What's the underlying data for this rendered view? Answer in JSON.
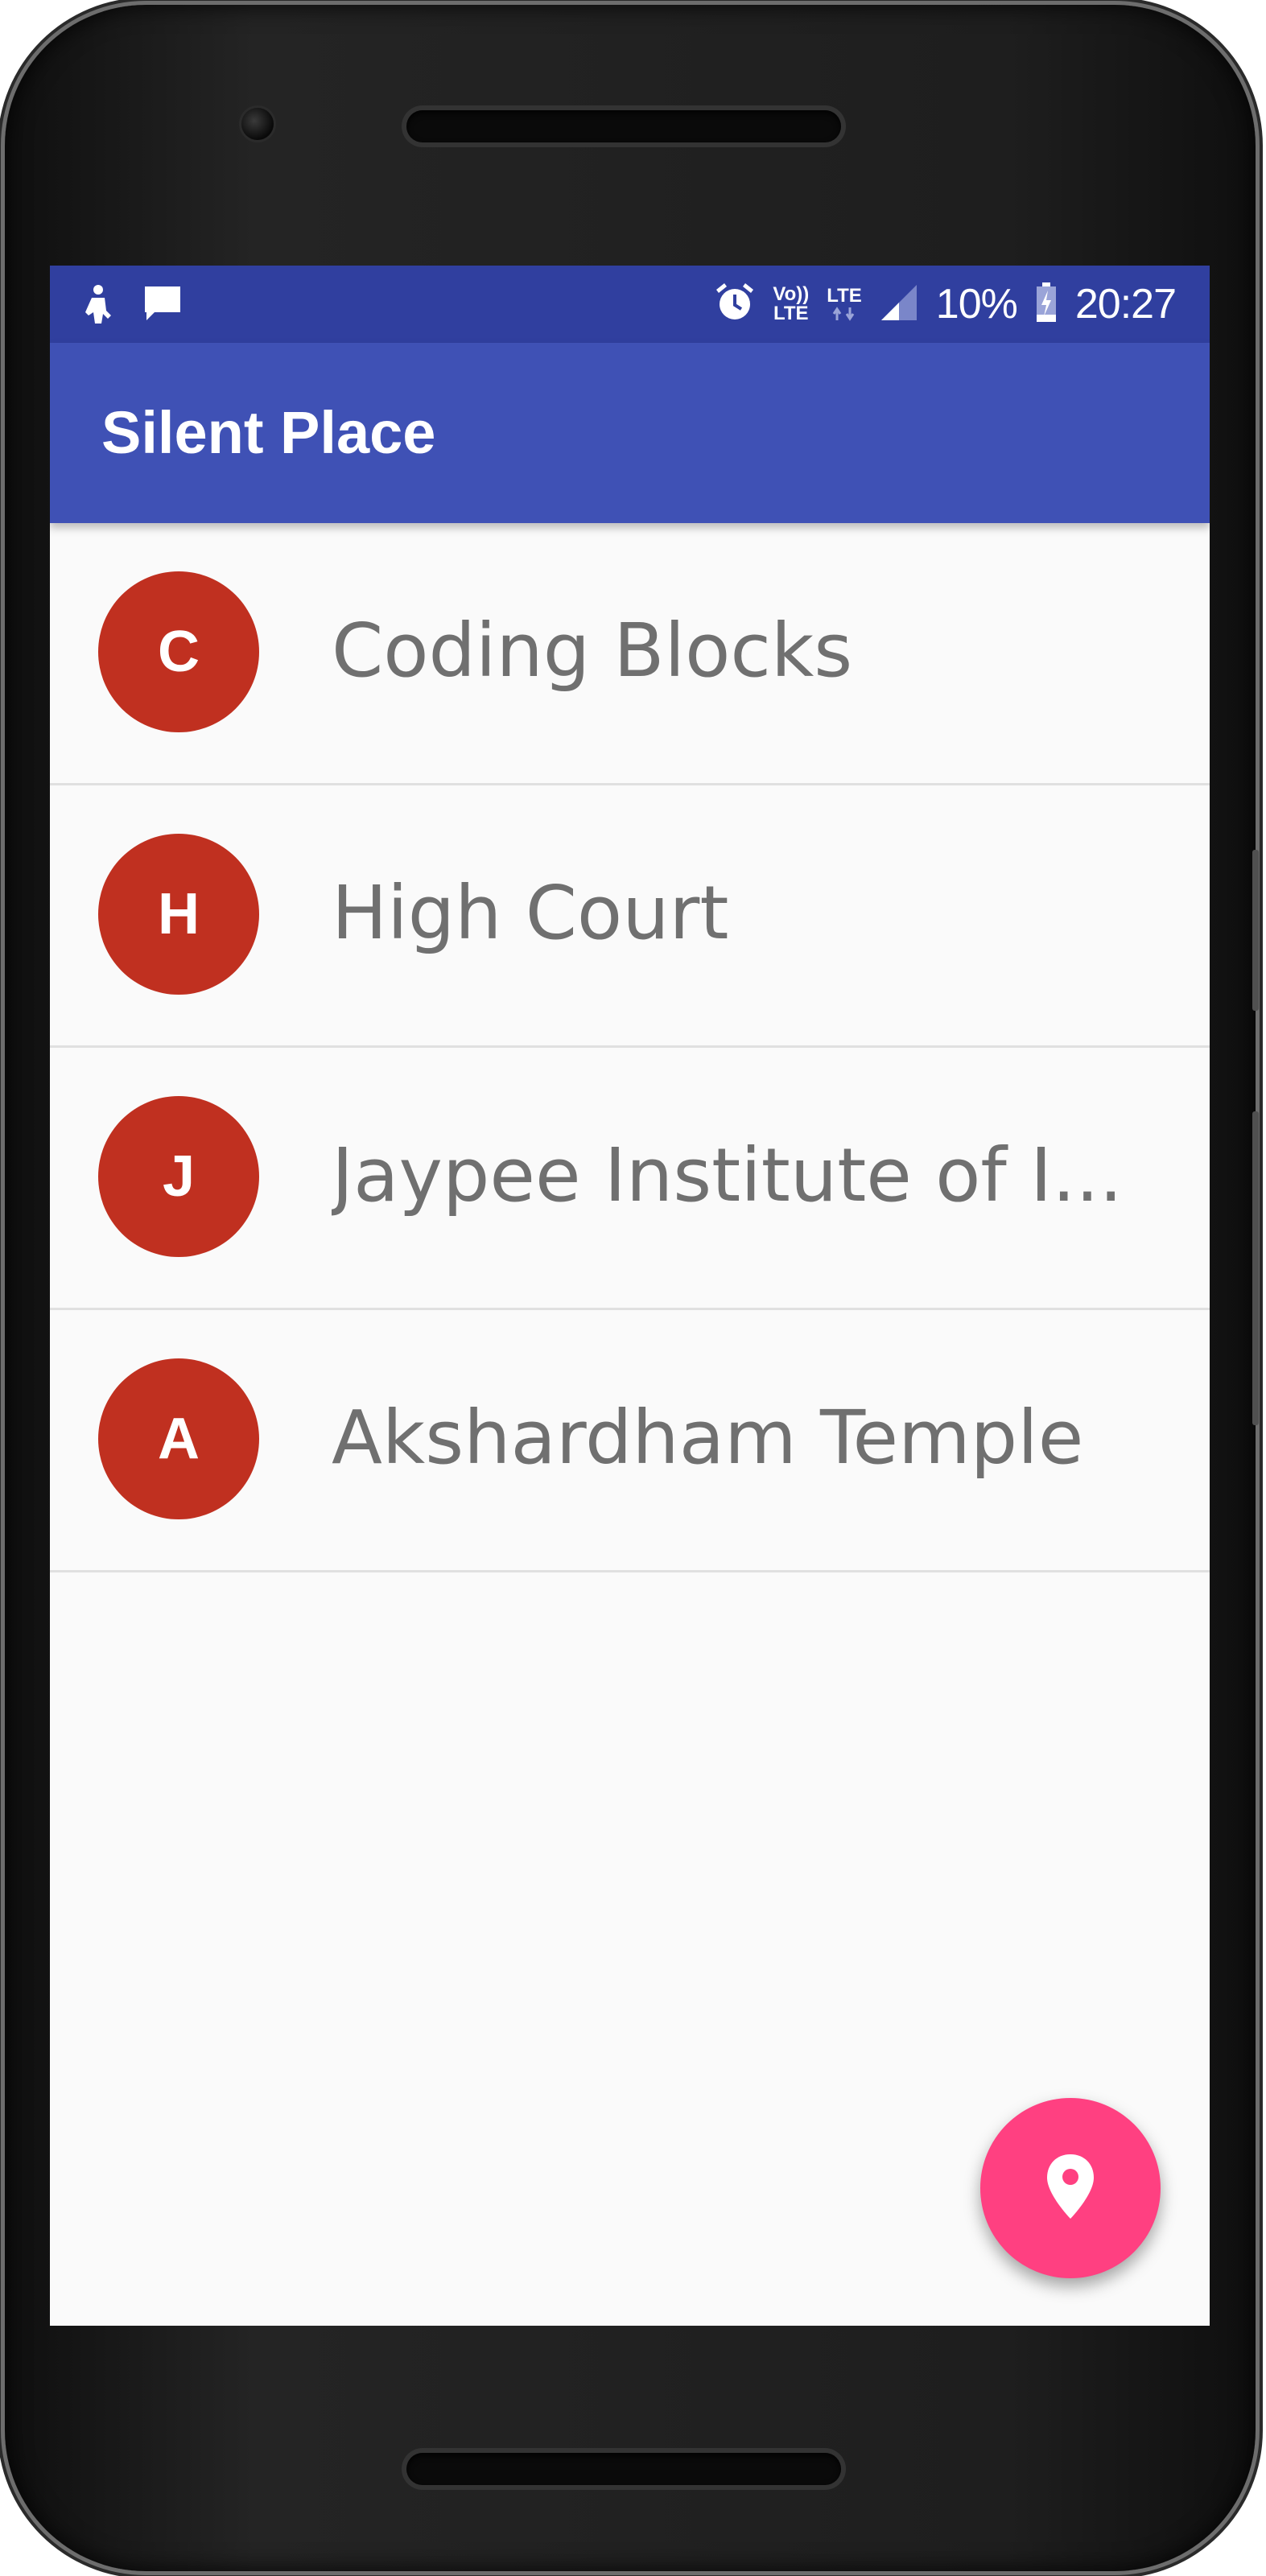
{
  "status_bar": {
    "left_icons": [
      "usb-debug-icon",
      "message-icon"
    ],
    "right_icons": [
      "alarm-icon",
      "volte-icon",
      "lte-data-icon",
      "signal-icon",
      "battery-charging-icon"
    ],
    "volte_line1": "Vo))",
    "volte_line2": "LTE",
    "lte_label": "LTE",
    "battery_percent": "10%",
    "time": "20:27",
    "bar_color": "#303f9f"
  },
  "app_bar": {
    "title": "Silent Place",
    "color": "#3f51b5"
  },
  "places": [
    {
      "initial": "C",
      "name": "Coding Blocks"
    },
    {
      "initial": "H",
      "name": "High Court"
    },
    {
      "initial": "J",
      "name": "Jaypee Institute of I..."
    },
    {
      "initial": "A",
      "name": "Akshardham Temple"
    }
  ],
  "avatar_color": "#c03020",
  "fab": {
    "icon": "location-pin-icon",
    "color": "#ff4081"
  }
}
